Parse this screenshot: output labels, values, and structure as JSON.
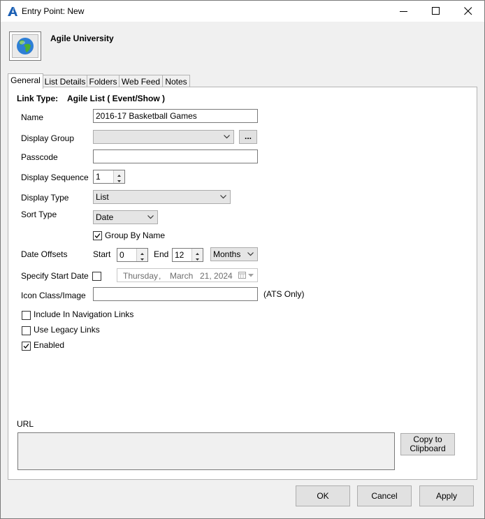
{
  "window": {
    "title": "Entry Point: New"
  },
  "header": {
    "org_name": "Agile University"
  },
  "tabs": [
    {
      "label": "General",
      "active": true
    },
    {
      "label": "List Details"
    },
    {
      "label": "Folders"
    },
    {
      "label": "Web Feed"
    },
    {
      "label": "Notes"
    }
  ],
  "form": {
    "link_type_label": "Link Type:",
    "link_type_value": "Agile List ( Event/Show )",
    "name_label": "Name",
    "name_value": "2016-17 Basketball Games",
    "display_group_label": "Display Group",
    "display_group_value": "",
    "display_group_browse": "...",
    "passcode_label": "Passcode",
    "passcode_value": "",
    "display_sequence_label": "Display Sequence",
    "display_sequence_value": "1",
    "display_type_label": "Display Type",
    "display_type_value": "List",
    "sort_type_label": "Sort Type",
    "sort_type_value": "Date",
    "group_by_name_label": "Group By Name",
    "group_by_name_checked": true,
    "date_offsets_label": "Date Offsets",
    "start_label": "Start",
    "start_value": "0",
    "end_label": "End",
    "end_value": "12",
    "unit_value": "Months",
    "specify_start_date_label": "Specify Start Date",
    "specify_start_date_checked": false,
    "date_weekday": "Thursday",
    "date_sep": ",",
    "date_month": "March",
    "date_day_year": "21, 2024",
    "icon_class_label": "Icon Class/Image",
    "icon_class_value": "",
    "icon_class_hint": "(ATS Only)",
    "include_nav_label": "Include In Navigation Links",
    "include_nav_checked": false,
    "legacy_links_label": "Use Legacy Links",
    "legacy_links_checked": false,
    "enabled_label": "Enabled",
    "enabled_checked": true
  },
  "url": {
    "label": "URL",
    "value": "",
    "copy_line1": "Copy to",
    "copy_line2": "Clipboard"
  },
  "footer": {
    "ok": "OK",
    "cancel": "Cancel",
    "apply": "Apply"
  },
  "colors": {
    "accent": "#1a5fb4",
    "disabled_text": "#6d6d6d"
  },
  "icons": [
    "app-logo-icon",
    "minimize-icon",
    "maximize-icon",
    "close-icon",
    "globe-icon",
    "chevron-down-icon",
    "calendar-icon",
    "checkmark-icon"
  ]
}
